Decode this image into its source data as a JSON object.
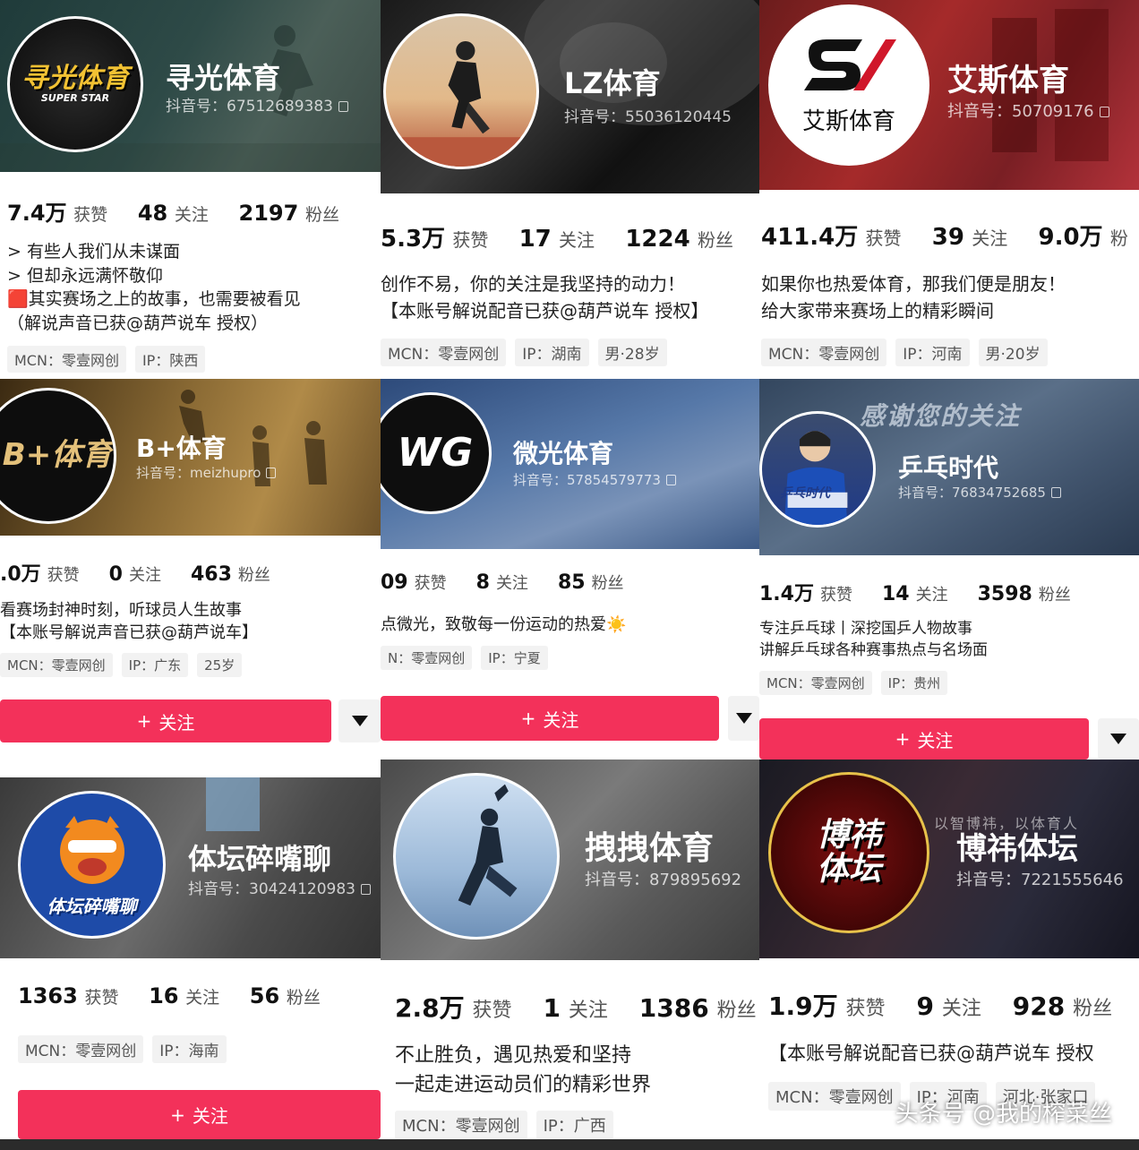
{
  "cards": [
    {
      "name": "寻光体育",
      "account": "抖音号：67512689383",
      "avatar_text": "寻光体育",
      "avatar_sub": "SUPER STAR",
      "likes_num": "7.4万",
      "likes_lbl": "获赞",
      "following_num": "48",
      "following_lbl": "关注",
      "fans_num": "2197",
      "fans_lbl": "粉丝",
      "bio": [
        "> 有些人我们从未谋面",
        ">  但却永远满怀敬仰",
        "🟥其实赛场之上的故事，也需要被看见",
        "（解说声音已获@葫芦说车  授权）"
      ],
      "tags": [
        "MCN：零壹网创",
        "IP：陕西"
      ]
    },
    {
      "name": "LZ体育",
      "account": "抖音号：55036120445",
      "likes_num": "5.3万",
      "likes_lbl": "获赞",
      "following_num": "17",
      "following_lbl": "关注",
      "fans_num": "1224",
      "fans_lbl": "粉丝",
      "bio": [
        "创作不易，你的关注是我坚持的动力！",
        "【本账号解说配音已获@葫芦说车 授权】"
      ],
      "tags": [
        "MCN：零壹网创",
        "IP：湖南",
        "男·28岁"
      ]
    },
    {
      "name": "艾斯体育",
      "account": "抖音号：50709176",
      "avatar_text": "艾斯体育",
      "likes_num": "411.4万",
      "likes_lbl": "获赞",
      "following_num": "39",
      "following_lbl": "关注",
      "fans_num": "9.0万",
      "fans_lbl": "粉",
      "bio": [
        "如果你也热爱体育，那我们便是朋友！",
        "给大家带来赛场上的精彩瞬间"
      ],
      "tags": [
        "MCN：零壹网创",
        "IP：河南",
        "男·20岁"
      ]
    },
    {
      "name": "B+体育",
      "account": "抖音号：meizhupro",
      "avatar_text": "B+体育",
      "likes_num": ".0万",
      "likes_lbl": "获赞",
      "following_num": "0",
      "following_lbl": "关注",
      "fans_num": "463",
      "fans_lbl": "粉丝",
      "bio": [
        "看赛场封神时刻，听球员人生故事",
        "【本账号解说声音已获@葫芦说车】"
      ],
      "tags": [
        "MCN：零壹网创",
        "IP：广东",
        "25岁"
      ],
      "follow": "关注"
    },
    {
      "name": "微光体育",
      "account": "抖音号：57854579773",
      "avatar_text": "WG",
      "likes_num": "09",
      "likes_lbl": "获赞",
      "following_num": "8",
      "following_lbl": "关注",
      "fans_num": "85",
      "fans_lbl": "粉丝",
      "bio": [
        "点微光，致敬每一份运动的热爱☀️"
      ],
      "tags": [
        "N：零壹网创",
        "IP：宁夏"
      ],
      "follow": "关注"
    },
    {
      "name": "乒乓时代",
      "account": "抖音号：76834752685",
      "banner_text": "感谢您的关注",
      "avatar_text": "乒乓时代",
      "likes_num": "1.4万",
      "likes_lbl": "获赞",
      "following_num": "14",
      "following_lbl": "关注",
      "fans_num": "3598",
      "fans_lbl": "粉丝",
      "bio": [
        "专注乒乓球丨深挖国乒人物故事",
        "讲解乒乓球各种赛事热点与名场面"
      ],
      "tags": [
        "MCN：零壹网创",
        "IP：贵州"
      ],
      "follow": "关注"
    },
    {
      "name": "体坛碎嘴聊",
      "account": "抖音号：30424120983",
      "avatar_text": "体坛碎嘴聊",
      "likes_num": "1363",
      "likes_lbl": "获赞",
      "following_num": "16",
      "following_lbl": "关注",
      "fans_num": "56",
      "fans_lbl": "粉丝",
      "tags": [
        "MCN：零壹网创",
        "IP：海南"
      ],
      "follow": "关注"
    },
    {
      "name": "拽拽体育",
      "account": "抖音号：879895692",
      "likes_num": "2.8万",
      "likes_lbl": "获赞",
      "following_num": "1",
      "following_lbl": "关注",
      "fans_num": "1386",
      "fans_lbl": "粉丝",
      "bio": [
        "不止胜负，遇见热爱和坚持",
        "一起走进运动员们的精彩世界"
      ],
      "tags": [
        "MCN：零壹网创",
        "IP：广西"
      ]
    },
    {
      "name": "博祎体坛",
      "account": "抖音号：7221555646",
      "banner_text": "以智博祎，以体育人",
      "avatar_text": "博祎体坛",
      "likes_num": "1.9万",
      "likes_lbl": "获赞",
      "following_num": "9",
      "following_lbl": "关注",
      "fans_num": "928",
      "fans_lbl": "粉丝",
      "bio": [
        "【本账号解说配音已获@葫芦说车 授权"
      ],
      "tags": [
        "MCN：零壹网创",
        "IP：河南",
        "河北·张家口"
      ]
    }
  ],
  "watermark": "头条号 @我的榨菜丝",
  "colors": {
    "follow": "#f3315a",
    "bg": "#ffffff"
  }
}
